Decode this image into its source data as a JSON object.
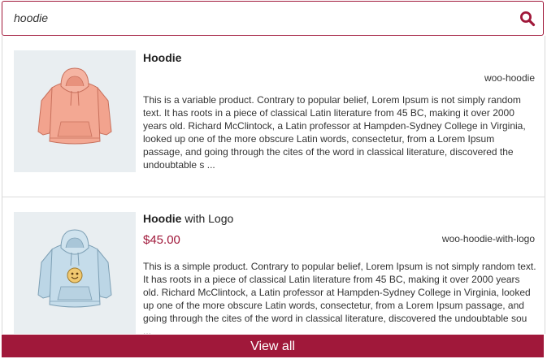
{
  "search": {
    "value": "hoodie",
    "icon": "search-icon",
    "accent_color": "#a0183a"
  },
  "results": [
    {
      "title_match": "Hoodie",
      "title_rest": "",
      "price": "",
      "sku": "woo-hoodie",
      "description": "This is a variable product. Contrary to popular belief, Lorem Ipsum is not simply random text. It has roots in a piece of classical Latin literature from 45 BC, making it over 2000 years old. Richard McClintock, a Latin professor at Hampden-Sydney College in Virginia, looked up one of the more obscure Latin words, consectetur, from a Lorem Ipsum passage, and going through the cites of the word in classical literature, discovered the undoubtable s ...",
      "image": "pink-hoodie-image"
    },
    {
      "title_match": "Hoodie",
      "title_rest": " with Logo",
      "price": "$45.00",
      "sku": "woo-hoodie-with-logo",
      "description": "This is a simple product. Contrary to popular belief, Lorem Ipsum is not simply random text. It has roots in a piece of classical Latin literature from 45 BC, making it over 2000 years old. Richard McClintock, a Latin professor at Hampden-Sydney College in Virginia, looked up one of the more obscure Latin words, consectetur, from a Lorem Ipsum passage, and going through the cites of the word in classical literature, discovered the undoubtable sou ...",
      "image": "blue-hoodie-with-logo-image"
    }
  ],
  "footer": {
    "view_all_label": "View all"
  }
}
